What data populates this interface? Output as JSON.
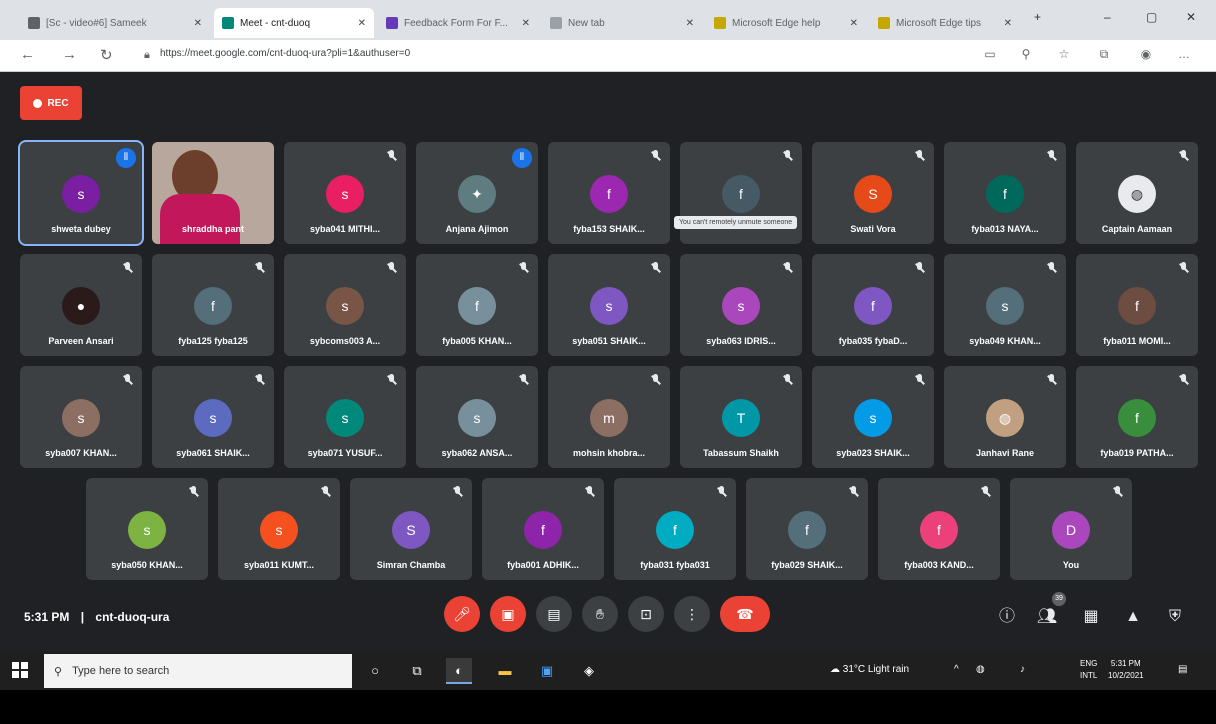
{
  "browser": {
    "tabs": [
      {
        "label": "[Sc - video#6] Sameek",
        "fav": "#5f6368"
      },
      {
        "label": "Meet - cnt-duoq",
        "fav": "#00897b"
      },
      {
        "label": "Feedback Form For F...",
        "fav": "#673ab7"
      },
      {
        "label": "New tab",
        "fav": "#9aa0a6"
      },
      {
        "label": "Microsoft Edge help",
        "fav": "#c6a700"
      },
      {
        "label": "Microsoft Edge tips",
        "fav": "#c6a700"
      }
    ],
    "url": "https://meet.google.com/cnt-duoq-ura?pli=1&authuser=0",
    "window_controls": [
      "–",
      "▢",
      "✕"
    ]
  },
  "meet": {
    "rec_label": "REC",
    "time": "5:31 PM",
    "meeting_code": "cnt-duoq-ura",
    "participants_count": "39",
    "tooltip": "You can't remotely unmute someone",
    "participants": [
      {
        "name": "shweta dubey",
        "initial": "s",
        "color": "#7b1fa2",
        "speaking": true
      },
      {
        "name": "shraddha pant",
        "photo": true
      },
      {
        "name": "syba041 MITHI...",
        "initial": "s",
        "color": "#e91e63"
      },
      {
        "name": "Anjana Ajimon",
        "initial": "✦",
        "color": "#5f7c80",
        "talk": true
      },
      {
        "name": "fyba153 SHAIK...",
        "initial": "f",
        "color": "#9c27b0"
      },
      {
        "name": "",
        "initial": "f",
        "color": "#455a64",
        "tooltip": true
      },
      {
        "name": "Swati Vora",
        "initial": "S",
        "color": "#e64a19"
      },
      {
        "name": "fyba013 NAYA...",
        "initial": "f",
        "color": "#00695c"
      },
      {
        "name": "Captain Aamaan",
        "initial": "◍",
        "color": "#e8eaed"
      },
      {
        "name": "Parveen Ansari",
        "initial": "●",
        "color": "#2a1a1a"
      },
      {
        "name": "fyba125 fyba125",
        "initial": "f",
        "color": "#546e7a"
      },
      {
        "name": "sybcoms003 A...",
        "initial": "s",
        "color": "#795548"
      },
      {
        "name": "fyba005 KHAN...",
        "initial": "f",
        "color": "#78909c"
      },
      {
        "name": "syba051 SHAIK...",
        "initial": "s",
        "color": "#7e57c2"
      },
      {
        "name": "syba063 IDRIS...",
        "initial": "s",
        "color": "#ab47bc"
      },
      {
        "name": "fyba035 fybaD...",
        "initial": "f",
        "color": "#7e57c2"
      },
      {
        "name": "syba049 KHAN...",
        "initial": "s",
        "color": "#546e7a"
      },
      {
        "name": "fyba011 MOMI...",
        "initial": "f",
        "color": "#6d4c41"
      },
      {
        "name": "syba007 KHAN...",
        "initial": "s",
        "color": "#8d6e63"
      },
      {
        "name": "syba061 SHAIK...",
        "initial": "s",
        "color": "#5c6bc0"
      },
      {
        "name": "syba071 YUSUF...",
        "initial": "s",
        "color": "#00897b"
      },
      {
        "name": "syba062 ANSA...",
        "initial": "s",
        "color": "#78909c"
      },
      {
        "name": "mohsin khobra...",
        "initial": "m",
        "color": "#8d6e63"
      },
      {
        "name": "Tabassum Shaikh",
        "initial": "T",
        "color": "#0097a7"
      },
      {
        "name": "syba023 SHAIK...",
        "initial": "s",
        "color": "#039be5"
      },
      {
        "name": "Janhavi Rane",
        "initial": "◍",
        "color": "#c0a080"
      },
      {
        "name": "fyba019 PATHA...",
        "initial": "f",
        "color": "#388e3c"
      },
      {
        "name": "syba050 KHAN...",
        "initial": "s",
        "color": "#7cb342"
      },
      {
        "name": "syba011 KUMT...",
        "initial": "s",
        "color": "#f4511e"
      },
      {
        "name": "Simran Chamba",
        "initial": "S",
        "color": "#7e57c2"
      },
      {
        "name": "fyba001 ADHIK...",
        "initial": "f",
        "color": "#8e24aa"
      },
      {
        "name": "fyba031 fyba031",
        "initial": "f",
        "color": "#00acc1"
      },
      {
        "name": "fyba029 SHAIK...",
        "initial": "f",
        "color": "#546e7a"
      },
      {
        "name": "fyba003 KAND...",
        "initial": "f",
        "color": "#ec407a"
      },
      {
        "name": "You",
        "initial": "D",
        "color": "#ab47bc"
      }
    ]
  },
  "taskbar": {
    "search_placeholder": "Type here to search",
    "weather": "31°C Light rain",
    "lang": "ENG",
    "region": "INTL",
    "time": "5:31 PM",
    "date": "10/2/2021"
  }
}
